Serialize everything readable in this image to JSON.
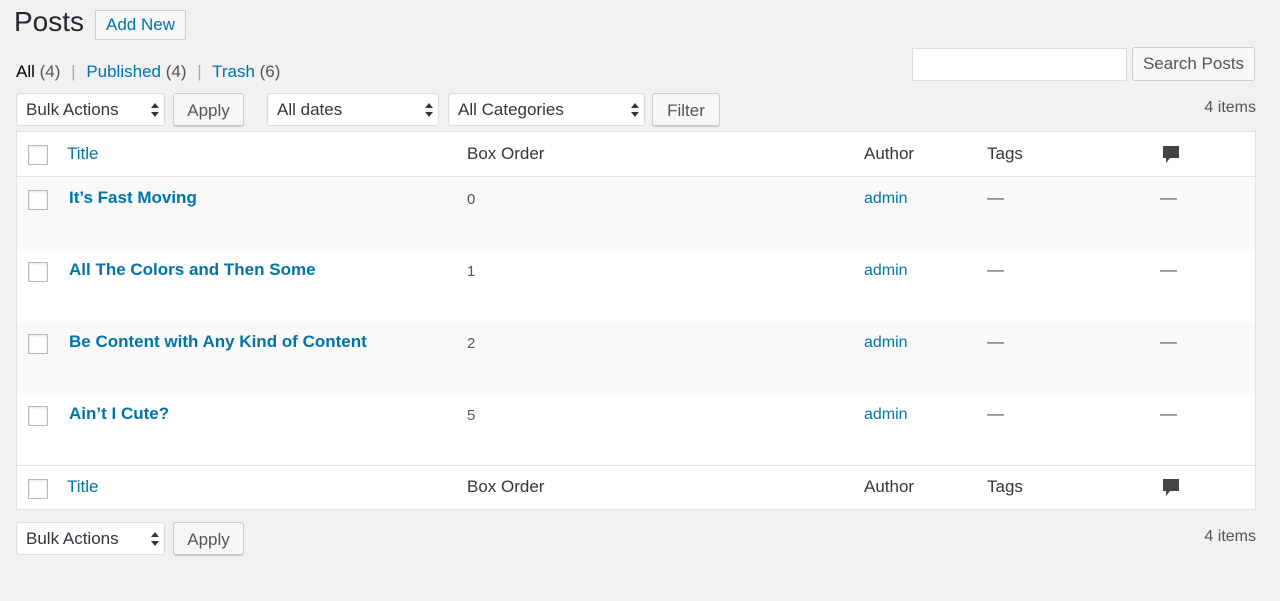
{
  "header": {
    "title": "Posts",
    "add_new": "Add New"
  },
  "views": {
    "all": {
      "label": "All",
      "count": "(4)"
    },
    "published": {
      "label": "Published",
      "count": "(4)"
    },
    "trash": {
      "label": "Trash",
      "count": "(6)"
    },
    "separator": "|"
  },
  "search": {
    "value": "",
    "button": "Search Posts"
  },
  "top_nav": {
    "bulk_actions": "Bulk Actions",
    "apply": "Apply",
    "dates": "All dates",
    "categories": "All Categories",
    "filter": "Filter",
    "items": "4 items"
  },
  "table": {
    "columns": {
      "title": "Title",
      "box_order": "Box Order",
      "author": "Author",
      "tags": "Tags",
      "comments_icon": "comment-bubble-icon"
    },
    "rows": [
      {
        "title": "It’s Fast Moving",
        "box_order": "0",
        "author": "admin",
        "tags": "—",
        "comments": "—"
      },
      {
        "title": "All The Colors and Then Some",
        "box_order": "1",
        "author": "admin",
        "tags": "—",
        "comments": "—"
      },
      {
        "title": "Be Content with Any Kind of Content",
        "box_order": "2",
        "author": "admin",
        "tags": "—",
        "comments": "—"
      },
      {
        "title": "Ain’t I Cute?",
        "box_order": "5",
        "author": "admin",
        "tags": "—",
        "comments": "—"
      }
    ]
  },
  "bottom_nav": {
    "bulk_actions": "Bulk Actions",
    "apply": "Apply",
    "items": "4 items"
  },
  "colors": {
    "link": "#0073aa",
    "background": "#f1f1f1",
    "alt_row": "#f9f9f9"
  }
}
